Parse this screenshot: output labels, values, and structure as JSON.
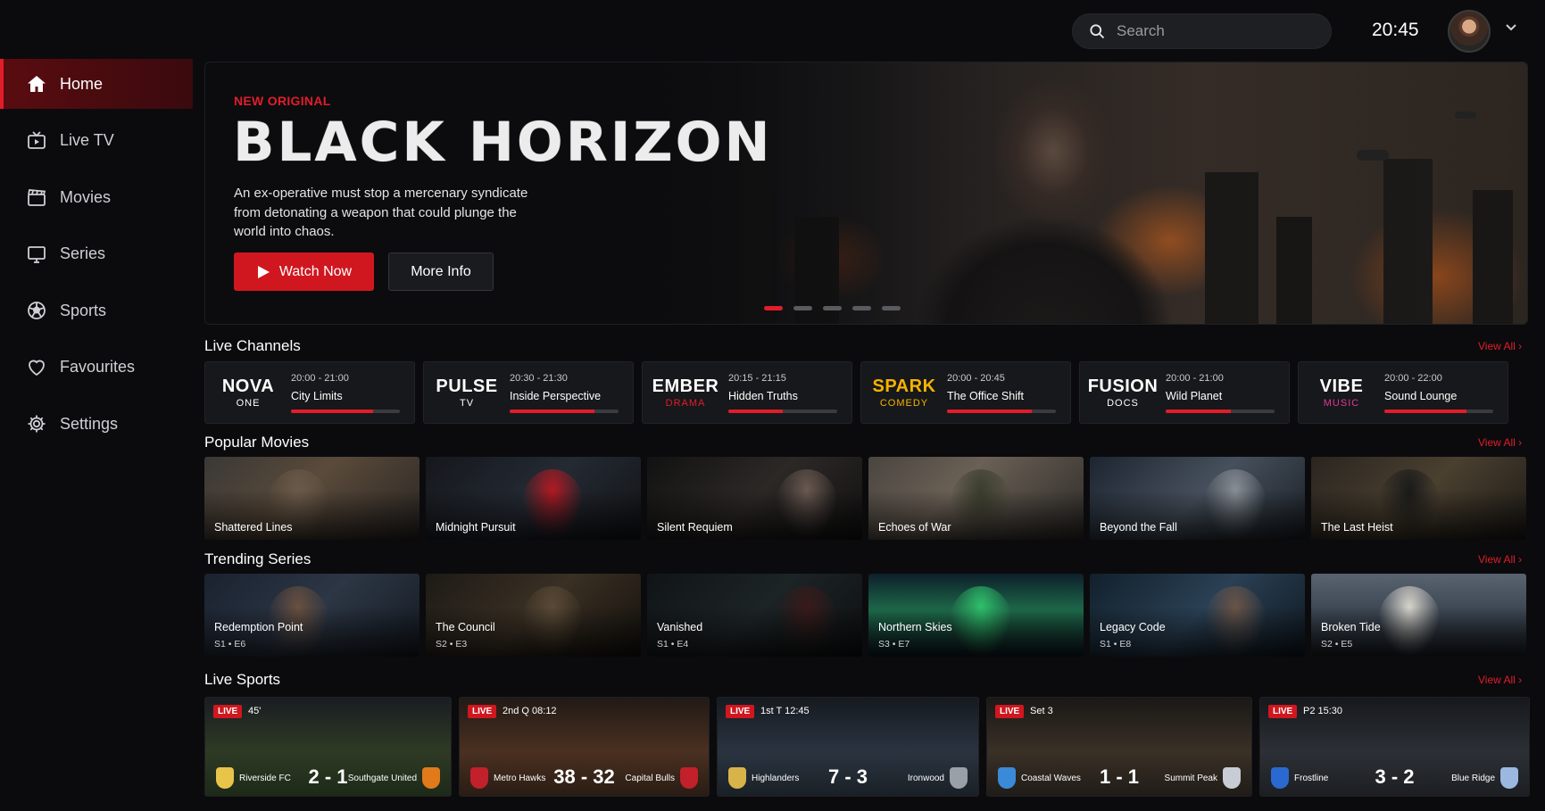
{
  "topbar": {
    "search_placeholder": "Search",
    "clock": "20:45"
  },
  "sidebar": {
    "items": [
      {
        "label": "Home",
        "icon": "home-icon",
        "active": true
      },
      {
        "label": "Live TV",
        "icon": "tv-icon"
      },
      {
        "label": "Movies",
        "icon": "clapperboard-icon"
      },
      {
        "label": "Series",
        "icon": "monitor-icon"
      },
      {
        "label": "Sports",
        "icon": "soccer-ball-icon"
      },
      {
        "label": "Favourites",
        "icon": "heart-icon"
      },
      {
        "label": "Settings",
        "icon": "gear-icon"
      }
    ]
  },
  "hero": {
    "tag": "NEW ORIGINAL",
    "title": "BLACK HORIZON",
    "description": "An ex-operative must stop a mercenary syndicate from detonating a weapon that could plunge the world into chaos.",
    "watch_label": "Watch Now",
    "more_label": "More Info",
    "slides": 5,
    "active_slide": 1
  },
  "colors": {
    "accent": "#e11d2a"
  },
  "live_channels": {
    "title": "Live Channels",
    "view_all": "View All ›",
    "items": [
      {
        "name": "NOVA",
        "sub": "ONE",
        "name_color": "#ffffff",
        "sub_color": "#ffffff",
        "time": "20:00 - 21:00",
        "show": "City Limits",
        "progress": 0.75
      },
      {
        "name": "PULSE",
        "sub": "TV",
        "name_color": "#ffffff",
        "sub_color": "#ffffff",
        "time": "20:30 - 21:30",
        "show": "Inside Perspective",
        "progress": 0.78
      },
      {
        "name": "EMBER",
        "sub": "DRAMA",
        "name_color": "#ffffff",
        "sub_color": "#e11d2a",
        "time": "20:15 - 21:15",
        "show": "Hidden Truths",
        "progress": 0.5
      },
      {
        "name": "SPARK",
        "sub": "COMEDY",
        "name_color": "#f5b301",
        "sub_color": "#f5b301",
        "time": "20:00 - 20:45",
        "show": "The Office Shift",
        "progress": 0.78
      },
      {
        "name": "FUSION",
        "sub": "DOCS",
        "name_color": "#ffffff",
        "sub_color": "#ffffff",
        "time": "20:00 - 21:00",
        "show": "Wild Planet",
        "progress": 0.6
      },
      {
        "name": "VIBE",
        "sub": "MUSIC",
        "name_color": "#ffffff",
        "sub_color": "#e0379a",
        "time": "20:00 - 22:00",
        "show": "Sound Lounge",
        "progress": 0.75
      }
    ]
  },
  "popular_movies": {
    "title": "Popular Movies",
    "view_all": "View All ›",
    "items": [
      {
        "title": "Shattered Lines",
        "bg": "linear-gradient(135deg,#3a3836 0%,#5a4a3a 45%,#2a2624 100%)",
        "accent": "#6a5a4a"
      },
      {
        "title": "Midnight Pursuit",
        "bg": "linear-gradient(135deg,#15171c 0%,#242a33 50%,#121316 100%)",
        "accent": "#b21a22"
      },
      {
        "title": "Silent Requiem",
        "bg": "linear-gradient(135deg,#121212 0%,#2c2826 50%,#111 100%)",
        "accent": "#6a5a52"
      },
      {
        "title": "Echoes of War",
        "bg": "linear-gradient(135deg,#4a4540 0%,#6a6055 40%,#2e2b28 100%)",
        "accent": "#3a3d2c"
      },
      {
        "title": "Beyond the Fall",
        "bg": "linear-gradient(135deg,#1c2530 0%,#46505c 50%,#1a1f26 100%)",
        "accent": "#8a8f96"
      },
      {
        "title": "The Last Heist",
        "bg": "linear-gradient(135deg,#2a2520 0%,#4a4030 50%,#1d1a16 100%)",
        "accent": "#1a1a1a"
      }
    ]
  },
  "trending_series": {
    "title": "Trending Series",
    "view_all": "View All ›",
    "items": [
      {
        "title": "Redemption Point",
        "ep": "S1 • E6",
        "bg": "linear-gradient(135deg,#1a2230 0%,#2c3644 50%,#141a22 100%)",
        "accent": "#6a5040"
      },
      {
        "title": "The Council",
        "ep": "S2 • E3",
        "bg": "linear-gradient(135deg,#1d1a16 0%,#3a3024 50%,#14110d 100%)",
        "accent": "#5a4a36"
      },
      {
        "title": "Vanished",
        "ep": "S1 • E4",
        "bg": "linear-gradient(135deg,#101416 0%,#1d2426 50%,#0c0f10 100%)",
        "accent": "#3a1a1a"
      },
      {
        "title": "Northern Skies",
        "ep": "S3 • E7",
        "bg": "linear-gradient(180deg,#0d1f2a 0%,#1e6a4a 45%,#0e1b22 100%)",
        "accent": "#2fbf6a"
      },
      {
        "title": "Legacy Code",
        "ep": "S1 • E8",
        "bg": "linear-gradient(135deg,#12202c 0%,#2a4054 50%,#0f1820 100%)",
        "accent": "#6a5448"
      },
      {
        "title": "Broken Tide",
        "ep": "S2 • E5",
        "bg": "linear-gradient(180deg,#5a6470 0%,#3a4450 50%,#1c2228 100%)",
        "accent": "#d8d4cc"
      }
    ]
  },
  "live_sports": {
    "title": "Live Sports",
    "view_all": "View All ›",
    "live_label": "LIVE",
    "items": [
      {
        "period": "45'",
        "home": "Riverside FC",
        "score": "2 - 1",
        "away": "Southgate United",
        "home_color": "#e8c54a",
        "away_color": "#e07a1a",
        "bg": "linear-gradient(180deg,#1a1d22 0%,#2e3a24 55%,#1d2a18 100%)"
      },
      {
        "period": "2nd Q 08:12",
        "home": "Metro Hawks",
        "score": "38 - 32",
        "away": "Capital Bulls",
        "home_color": "#c2202a",
        "away_color": "#c2202a",
        "bg": "linear-gradient(180deg,#221a16 0%,#4a3020 55%,#2a1c14 100%)"
      },
      {
        "period": "1st T 12:45",
        "home": "Highlanders",
        "score": "7 - 3",
        "away": "Ironwood",
        "home_color": "#d8b34a",
        "away_color": "#9aa0a8",
        "bg": "linear-gradient(180deg,#161a20 0%,#2a3440 55%,#1a2026 100%)"
      },
      {
        "period": "Set 3",
        "home": "Coastal Waves",
        "score": "1 - 1",
        "away": "Summit Peak",
        "home_color": "#3a8ad8",
        "away_color": "#c8ccd4",
        "bg": "linear-gradient(180deg,#1a1816 0%,#3a3026 55%,#201c18 100%)"
      },
      {
        "period": "P2 15:30",
        "home": "Frostline",
        "score": "3 - 2",
        "away": "Blue Ridge",
        "home_color": "#2a6ad0",
        "away_color": "#9ab8e0",
        "bg": "linear-gradient(180deg,#16181c 0%,#2c3036 55%,#1c1e22 100%)"
      }
    ]
  }
}
